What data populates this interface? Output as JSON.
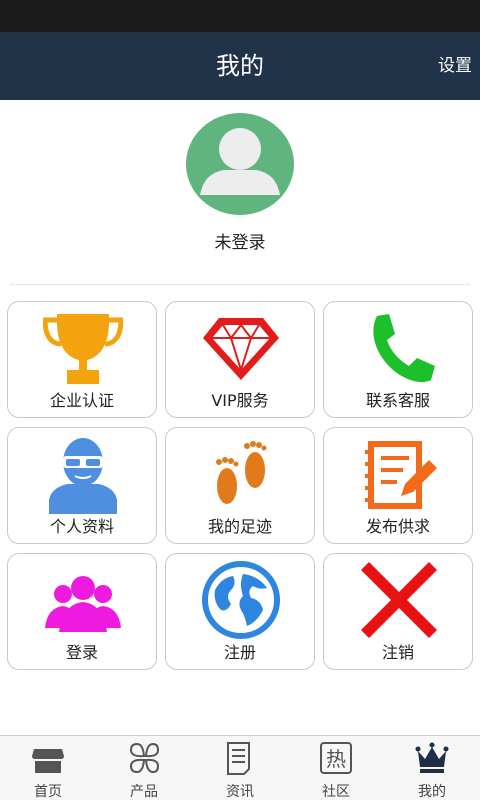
{
  "header": {
    "title": "我的",
    "settings_label": "设置"
  },
  "profile": {
    "username": "未登录",
    "avatar_icon": "default-user-avatar-icon"
  },
  "grid": {
    "items": [
      {
        "label": "企业认证",
        "icon": "trophy-icon"
      },
      {
        "label": "VIP服务",
        "icon": "diamond-icon"
      },
      {
        "label": "联系客服",
        "icon": "phone-icon"
      },
      {
        "label": "个人资料",
        "icon": "person-icon"
      },
      {
        "label": "我的足迹",
        "icon": "footprints-icon"
      },
      {
        "label": "发布供求",
        "icon": "edit-document-icon"
      },
      {
        "label": "登录",
        "icon": "group-icon"
      },
      {
        "label": "注册",
        "icon": "globe-icon"
      },
      {
        "label": "注销",
        "icon": "x-icon"
      }
    ]
  },
  "tabbar": {
    "items": [
      {
        "label": "首页",
        "icon": "store-icon"
      },
      {
        "label": "产品",
        "icon": "clover-icon"
      },
      {
        "label": "资讯",
        "icon": "document-icon"
      },
      {
        "label": "社区",
        "icon": "hot-icon",
        "icon_text": "热"
      },
      {
        "label": "我的",
        "icon": "crown-icon",
        "active": true
      }
    ]
  },
  "colors": {
    "header_bg": "#213349",
    "avatar_bg": "#5fb57d",
    "trophy": "#f5a20f",
    "diamond": "#e21b1b",
    "phone": "#1dbf2a",
    "person": "#4f8fe0",
    "footprints": "#e07a1a",
    "edit": "#f26a1a",
    "group": "#ee1ae0",
    "globe": "#2e86de",
    "x": "#e81212"
  }
}
